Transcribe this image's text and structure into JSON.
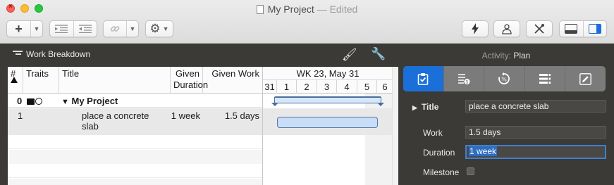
{
  "window": {
    "title": "My Project",
    "status": "— Edited"
  },
  "toolbar": {
    "add_label": "+",
    "indent_icon": "indent-icon",
    "outdent_icon": "outdent-icon",
    "link_icon": "link-icon",
    "gear_icon": "gear-icon",
    "lightning_icon": "lightning-icon",
    "person_icon": "person-icon",
    "tools_icon": "tools-icon"
  },
  "left_header": {
    "work_breakdown_label": "Work Breakdown"
  },
  "table": {
    "columns": [
      "#",
      "Traits",
      "Title",
      "Given Duration",
      "Given Work"
    ],
    "rows": [
      {
        "num": "0",
        "title": "My Project",
        "given_duration": "",
        "given_work": ""
      },
      {
        "num": "1",
        "title": "place a concrete slab",
        "given_duration": "1 week",
        "given_work": "1.5 days"
      }
    ]
  },
  "gantt": {
    "week_label": "WK 23, May 31",
    "days": [
      "31",
      "1",
      "2",
      "3",
      "4",
      "5",
      "6"
    ]
  },
  "inspector": {
    "activity_prefix": "Activity:",
    "activity_value": "Plan",
    "title_label": "Title",
    "title_value": "place a concrete slab",
    "work_label": "Work",
    "work_value": "1.5 days",
    "duration_label": "Duration",
    "duration_value": "1 week",
    "milestone_label": "Milestone",
    "milestone_checked": false,
    "tabs": [
      "clipboard-check-icon",
      "cost-icon",
      "percent-complete-icon",
      "list-icon",
      "pencil-icon"
    ]
  },
  "colors": {
    "accent": "#1b6fd8",
    "inspector_bg": "#3c3a37",
    "bar_fill": "#c9ddf7"
  }
}
